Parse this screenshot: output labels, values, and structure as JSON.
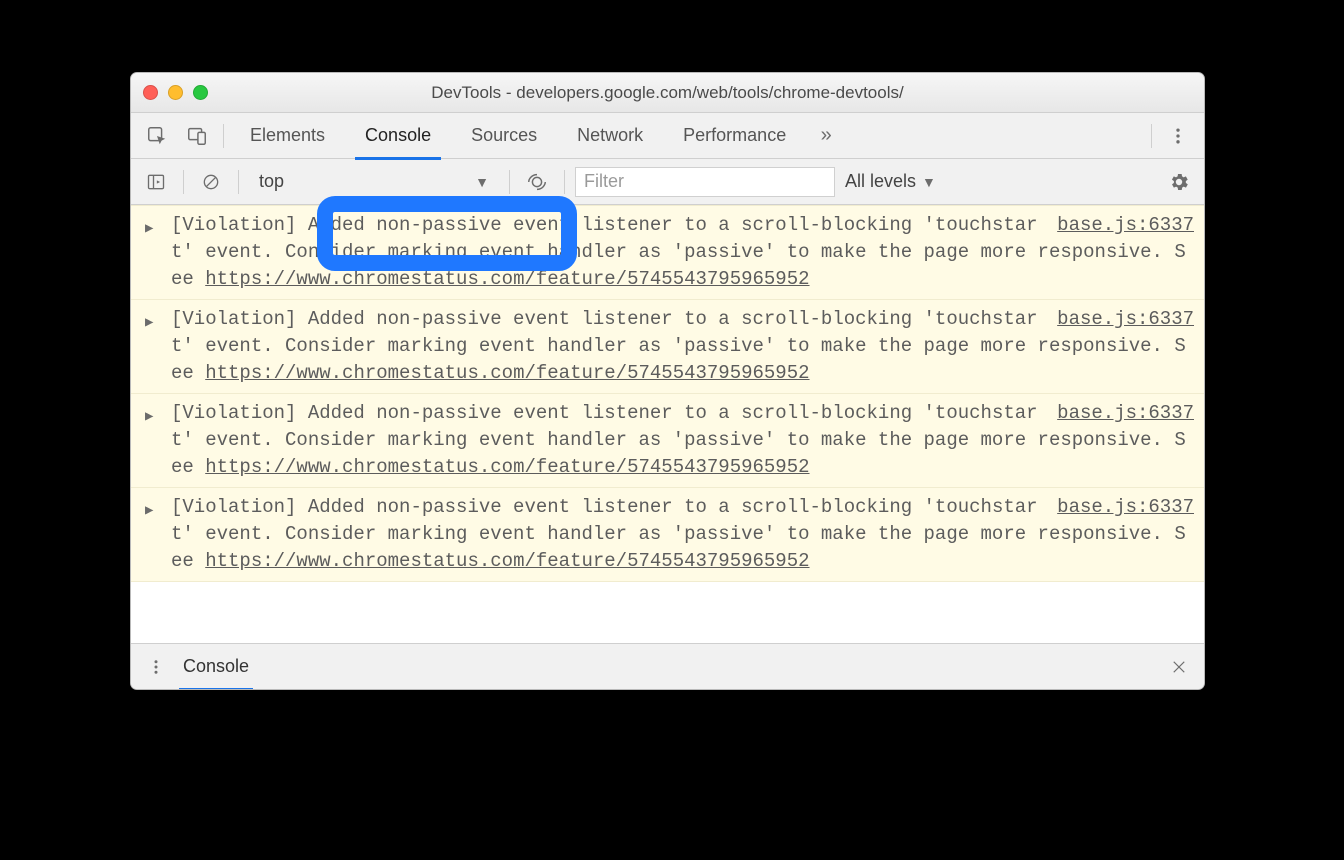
{
  "window": {
    "title": "DevTools - developers.google.com/web/tools/chrome-devtools/"
  },
  "tabs": {
    "items": [
      "Elements",
      "Console",
      "Sources",
      "Network",
      "Performance"
    ],
    "active": "Console"
  },
  "console_bar": {
    "context": "top",
    "filter_placeholder": "Filter",
    "levels": "All levels"
  },
  "drawer": {
    "tab": "Console"
  },
  "log": {
    "violation_prefix": "[Violation] ",
    "body_before_link": "Added non-passive event listener to a scroll-blocking 'touchstart' event. Consider marking event handler as 'passive' to make the page more responsive. See ",
    "link_text": "https://www.chromestatus.com/feature/5745543795965952",
    "source": "base.js:6337",
    "repeat": 4
  }
}
